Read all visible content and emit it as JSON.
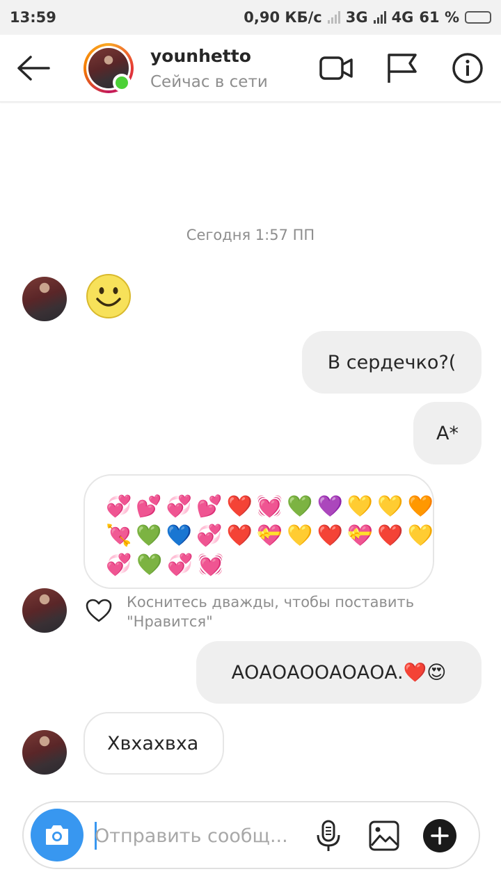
{
  "status_bar": {
    "time": "13:59",
    "speed": "0,90 КБ/с",
    "net1": "3G",
    "net2": "4G",
    "battery": "61 %",
    "battery_level": 0.61,
    "battery_color": "#f5a623"
  },
  "header": {
    "username": "younhetto",
    "presence": "Сейчас в сети",
    "icons": [
      "back-arrow-icon",
      "video-call-icon",
      "flag-icon",
      "info-icon"
    ],
    "online_color": "#4cd137"
  },
  "conversation": {
    "timestamp": "Сегодня 1:57 ПП",
    "messages": [
      {
        "from": "them",
        "type": "emoji",
        "text": "🙂"
      },
      {
        "from": "me",
        "type": "text",
        "text": "В сердечко?("
      },
      {
        "from": "me",
        "type": "text",
        "text": "А*"
      },
      {
        "from": "them",
        "type": "emoji-grid",
        "rows": [
          [
            "💞",
            "💕",
            "💞",
            "💕",
            "❤️",
            "💓",
            "💚",
            "💜",
            "💛",
            "💛",
            "🧡"
          ],
          [
            "💘",
            "💚",
            "💙",
            "💞",
            "❤️",
            "💝",
            "💛",
            "❤️",
            "💝",
            "❤️",
            "💛"
          ],
          [
            "💞",
            "💚",
            "💞",
            "💓"
          ]
        ]
      },
      {
        "from": "me",
        "type": "text",
        "text": "АОАОАООАОАОА.❤️😍"
      },
      {
        "from": "them",
        "type": "text",
        "text": "Хвхахвха"
      }
    ],
    "like_hint_line1": "Коснитесь дважды, чтобы поставить",
    "like_hint_line2": "\"Нравится\""
  },
  "composer": {
    "placeholder": "Отправить сообщ...",
    "value": "",
    "accent": "#3897f0",
    "icons": [
      "camera-icon",
      "microphone-icon",
      "gallery-icon",
      "plus-icon"
    ]
  }
}
